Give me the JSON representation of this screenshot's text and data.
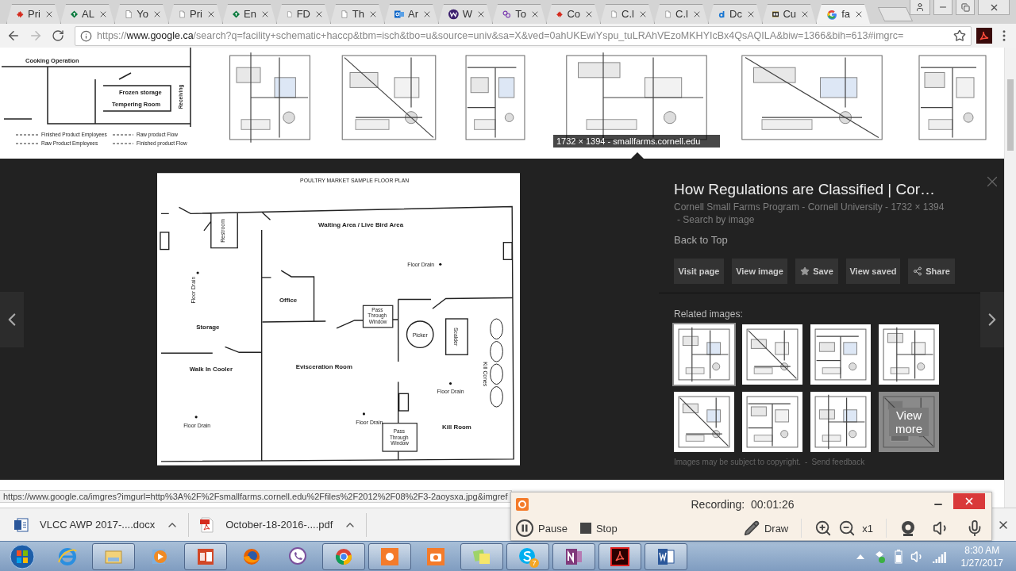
{
  "tabs": [
    {
      "title": "Pri",
      "kind": "maple",
      "selected": false
    },
    {
      "title": "AL",
      "kind": "diamond",
      "selected": false
    },
    {
      "title": "Yo",
      "kind": "doc",
      "selected": false
    },
    {
      "title": "Pri",
      "kind": "doc",
      "selected": false
    },
    {
      "title": "En",
      "kind": "diamond",
      "selected": false
    },
    {
      "title": "FD",
      "kind": "doc",
      "selected": false
    },
    {
      "title": "Th",
      "kind": "doc",
      "selected": false
    },
    {
      "title": "Ar",
      "kind": "outlook",
      "selected": false
    },
    {
      "title": "W",
      "kind": "wmark",
      "selected": false
    },
    {
      "title": "To",
      "kind": "link",
      "selected": false
    },
    {
      "title": "Co",
      "kind": "maple",
      "selected": false
    },
    {
      "title": "C.l",
      "kind": "doc",
      "selected": false
    },
    {
      "title": "C.l",
      "kind": "doc",
      "selected": false
    },
    {
      "title": "Dc",
      "kind": "dmark",
      "selected": false
    },
    {
      "title": "Cu",
      "kind": "bb",
      "selected": false
    },
    {
      "title": "fa",
      "kind": "google",
      "selected": true
    }
  ],
  "nav_buttons": [
    {
      "kind": "back",
      "disabled": false
    },
    {
      "kind": "forward",
      "disabled": true
    },
    {
      "kind": "reload",
      "disabled": false
    }
  ],
  "address_bar": {
    "scheme": "https://",
    "host": "www.google.ca",
    "path": "/search?q=facility+schematic+haccp&tbm=isch&tbo=u&source=univ&sa=X&ved=0ahUKEwiYspu_tuLRAhVEzoMKHYIcBx4QsAQILA&biw=1366&bih=613#imgrc="
  },
  "thumbnail_strip": [
    {
      "kind": "labeled",
      "labels": [
        "Cooking Operation",
        "Frozen storage",
        "Tempering Room",
        "Receiving",
        "Finished Product Employees",
        "Raw Product Employees",
        "Raw product Flow",
        "Finished product Flow"
      ]
    },
    {
      "kind": "picture"
    },
    {
      "kind": "picture"
    },
    {
      "kind": "picture"
    },
    {
      "kind": "picture",
      "caption": "1732 × 1394 - smallfarms.cornell.edu"
    },
    {
      "kind": "picture"
    },
    {
      "kind": "picture"
    }
  ],
  "preview": {
    "floor_plan_labels": [
      "POULTRY MARKET SAMPLE FLOOR PLAN",
      "Waiting Area / Live Bird Area",
      "Restroom",
      "Floor Drain",
      "Floor Drain",
      "Office",
      "Storage",
      "Pass Through Window",
      "Picker",
      "Scalder",
      "Walk In Cooler",
      "Evisceration Room",
      "Kill Cones",
      "Floor Drain",
      "Floor Drain",
      "Floor Drain",
      "Kill Room",
      "Pass Through Window"
    ]
  },
  "info": {
    "title": "How Regulations are Classified | Cor…",
    "source": "Cornell Small Farms Program - Cornell University",
    "size": "- 1732 × 1394",
    "search_by_image": "- Search by image",
    "back_to_top": "Back to Top",
    "buttons": [
      {
        "label": "Visit page",
        "kind": "text"
      },
      {
        "label": "View image",
        "kind": "text"
      },
      {
        "label": "Save",
        "kind": "star"
      },
      {
        "label": "View saved",
        "kind": "text"
      },
      {
        "label": "Share",
        "kind": "share"
      }
    ],
    "related_heading": "Related images:",
    "related_images": [
      {
        "kind": "picture",
        "selected": true
      },
      {
        "kind": "picture",
        "selected": false
      },
      {
        "kind": "picture",
        "selected": false
      },
      {
        "kind": "picture",
        "selected": false
      },
      {
        "kind": "picture",
        "selected": false
      },
      {
        "kind": "picture",
        "selected": false
      },
      {
        "kind": "picture",
        "selected": false
      },
      {
        "kind": "more",
        "label": "View more",
        "selected": false
      }
    ],
    "copyright": "Images may be subject to copyright.",
    "separator": "-",
    "feedback": "Send feedback"
  },
  "status_url": "https://www.google.ca/imgres?imgurl=http%3A%2F%2Fsmallfarms.cornell.edu%2Ffiles%2F2012%2F08%2F3-2aoysxa.jpg&imgref",
  "downloads": [
    {
      "name": "VLCC AWP 2017-....docx",
      "kind": "word"
    },
    {
      "name": "October-18-2016-....pdf",
      "kind": "pdf"
    }
  ],
  "recorder": {
    "status": "Recording:  00:01:26",
    "pause": "Pause",
    "stop": "Stop",
    "draw": "Draw",
    "zoom": "x1"
  },
  "taskbar": {
    "apps": [
      {
        "kind": "ie",
        "running": false
      },
      {
        "kind": "explorer",
        "running": true
      },
      {
        "kind": "media",
        "running": false
      },
      {
        "kind": "powerpoint",
        "running": true
      },
      {
        "kind": "firefox",
        "running": false
      },
      {
        "kind": "viber",
        "running": false
      },
      {
        "kind": "chrome",
        "running": true
      },
      {
        "kind": "recorder",
        "running": true
      },
      {
        "kind": "camera",
        "running": false
      },
      {
        "kind": "stickies",
        "running": true
      },
      {
        "kind": "skype",
        "running": true,
        "badge": "7"
      },
      {
        "kind": "onenote",
        "running": true
      },
      {
        "kind": "acrobat",
        "running": true
      },
      {
        "kind": "word",
        "running": true
      }
    ],
    "time": "8:30 AM",
    "date": "1/27/2017"
  }
}
